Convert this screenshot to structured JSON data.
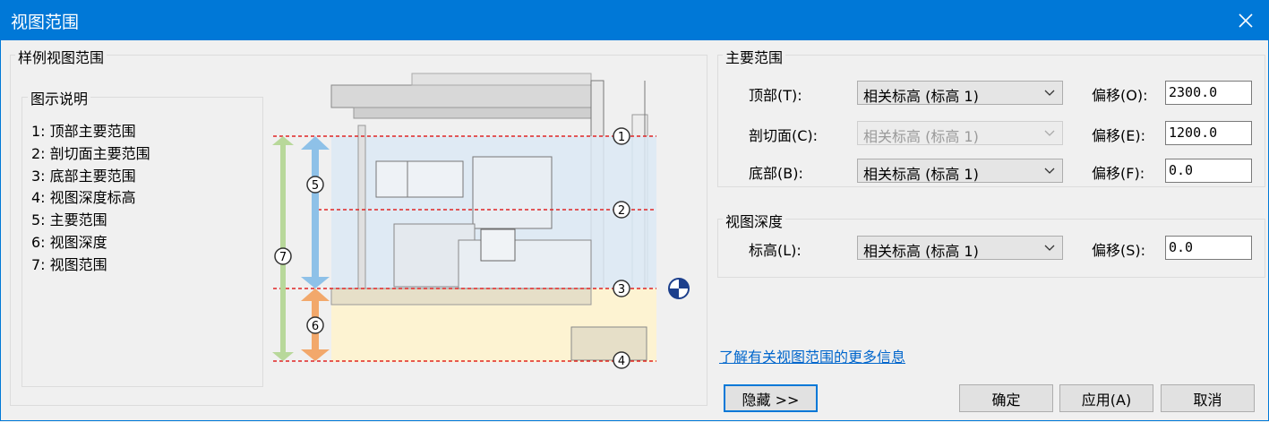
{
  "window": {
    "title": "视图范围",
    "close_icon": "close-icon"
  },
  "sample": {
    "group_title": "样例视图范围",
    "legend_title": "图示说明",
    "legend_items": [
      "1: 顶部主要范围",
      "2: 剖切面主要范围",
      "3: 底部主要范围",
      "4: 视图深度标高",
      "5: 主要范围",
      "6: 视图深度",
      "7: 视图范围"
    ],
    "markers": [
      "1",
      "2",
      "3",
      "4",
      "5",
      "6",
      "7"
    ]
  },
  "primary": {
    "group_title": "主要范围",
    "rows": [
      {
        "label": "顶部(T):",
        "level": "相关标高 (标高 1)",
        "offset_label": "偏移(O):",
        "offset": "2300.0"
      },
      {
        "label": "剖切面(C):",
        "level": "相关标高 (标高 1)",
        "offset_label": "偏移(E):",
        "offset": "1200.0"
      },
      {
        "label": "底部(B):",
        "level": "相关标高 (标高 1)",
        "offset_label": "偏移(F):",
        "offset": "0.0"
      }
    ]
  },
  "depth": {
    "group_title": "视图深度",
    "row": {
      "label": "标高(L):",
      "level": "相关标高 (标高 1)",
      "offset_label": "偏移(S):",
      "offset": "0.0"
    }
  },
  "link_text": "了解有关视图范围的更多信息",
  "buttons": {
    "hide": "隐藏 >>",
    "ok": "确定",
    "apply": "应用(A)",
    "cancel": "取消"
  },
  "colors": {
    "title_bar": "#0078d7",
    "link": "#0066cc",
    "primary_range": "#dce9f5",
    "depth_range": "#fdf3d2"
  }
}
